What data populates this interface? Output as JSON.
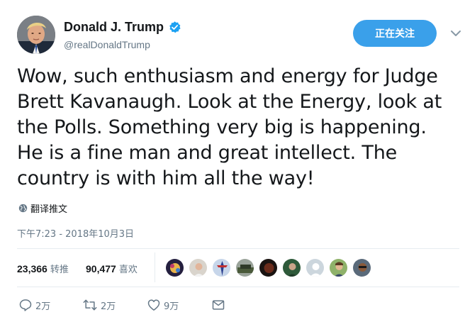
{
  "author": {
    "display_name": "Donald J. Trump",
    "handle": "@realDonaldTrump",
    "verified": true
  },
  "follow_button": {
    "label": "正在关注"
  },
  "tweet": {
    "lines": [
      "Wow, such enthusiasm and energy for Judge",
      "Brett Kavanaugh. Look at the Energy, look at",
      "the Polls. Something very big is happening.",
      "He is a fine man and great intellect. The",
      "country is with him all the way!"
    ]
  },
  "translate_label": "翻译推文",
  "timestamp": "下午7:23 - 2018年10月3日",
  "stats": {
    "retweets_count": "23,366",
    "retweets_label": "转推",
    "likes_count": "90,477",
    "likes_label": "喜欢"
  },
  "actions": {
    "reply_count": "2万",
    "retweet_count": "2万",
    "like_count": "9万"
  },
  "icons": {
    "verified": "verified-badge-icon",
    "menu": "chevron-down-icon",
    "translate": "globe-icon",
    "reply": "reply-icon",
    "retweet": "retweet-icon",
    "like": "heart-icon",
    "dm": "envelope-icon"
  },
  "colors": {
    "accent": "#1da1f2",
    "follow_button": "#3aa0ea",
    "text": "#14171a",
    "muted": "#657786",
    "divider": "#e6ecf0"
  }
}
